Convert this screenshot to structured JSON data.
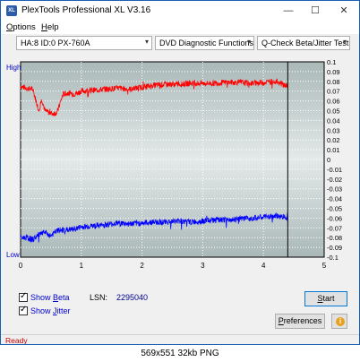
{
  "window": {
    "title": "PlexTools Professional XL V3.16",
    "icon": "XL",
    "controls": {
      "minimize": "—",
      "maximize": "☐",
      "close": "✕"
    }
  },
  "menu": {
    "options": {
      "mnemonic": "O",
      "rest": "ptions"
    },
    "help": {
      "mnemonic": "H",
      "rest": "elp"
    }
  },
  "toolbar": {
    "drive": "HA:8 ID:0  PX-760A",
    "function": "DVD Diagnostic Functions",
    "test": "Q-Check Beta/Jitter Test"
  },
  "chart_data": {
    "type": "line",
    "x_ticks": [
      "0",
      "1",
      "2",
      "3",
      "4",
      "5"
    ],
    "xlim": [
      0,
      5
    ],
    "left_labels": {
      "high": "High",
      "low": "Low"
    },
    "right_ticks": [
      "0.1",
      "0.09",
      "0.08",
      "0.07",
      "0.06",
      "0.05",
      "0.04",
      "0.03",
      "0.02",
      "0.01",
      "0",
      "-0.01",
      "-0.02",
      "-0.03",
      "-0.04",
      "-0.05",
      "-0.06",
      "-0.07",
      "-0.08",
      "-0.09",
      "-0.1"
    ],
    "ylim": [
      -0.1,
      0.1
    ],
    "end_marker_x": 4.4,
    "series": [
      {
        "name": "Beta",
        "color": "#ff0000",
        "x": [
          0,
          0.1,
          0.2,
          0.3,
          0.35,
          0.4,
          0.5,
          0.6,
          0.7,
          0.8,
          0.9,
          1.0,
          1.2,
          1.4,
          1.6,
          1.8,
          2.0,
          2.2,
          2.4,
          2.6,
          2.8,
          3.0,
          3.2,
          3.4,
          3.6,
          3.8,
          4.0,
          4.2,
          4.4
        ],
        "y": [
          0.075,
          0.073,
          0.072,
          0.05,
          0.062,
          0.05,
          0.047,
          0.048,
          0.067,
          0.068,
          0.067,
          0.07,
          0.071,
          0.072,
          0.073,
          0.072,
          0.074,
          0.076,
          0.077,
          0.077,
          0.078,
          0.078,
          0.078,
          0.079,
          0.079,
          0.078,
          0.079,
          0.08,
          0.075
        ]
      },
      {
        "name": "Jitter",
        "color": "#0000ff",
        "x": [
          0,
          0.1,
          0.2,
          0.3,
          0.4,
          0.5,
          0.6,
          0.7,
          0.8,
          0.9,
          1.0,
          1.2,
          1.4,
          1.6,
          1.8,
          2.0,
          2.2,
          2.4,
          2.6,
          2.8,
          3.0,
          3.2,
          3.4,
          3.6,
          3.8,
          4.0,
          4.2,
          4.4
        ],
        "y": [
          -0.08,
          -0.08,
          -0.082,
          -0.077,
          -0.075,
          -0.078,
          -0.073,
          -0.072,
          -0.072,
          -0.071,
          -0.069,
          -0.068,
          -0.067,
          -0.065,
          -0.066,
          -0.065,
          -0.064,
          -0.064,
          -0.063,
          -0.064,
          -0.063,
          -0.062,
          -0.062,
          -0.061,
          -0.06,
          -0.059,
          -0.058,
          -0.059
        ]
      }
    ]
  },
  "controls": {
    "show_beta": {
      "prefix": "Show ",
      "mnemonic": "B",
      "rest": "eta",
      "checked": true
    },
    "show_jitter": {
      "prefix": "Show ",
      "mnemonic": "J",
      "rest": "itter",
      "checked": true
    },
    "lsn_label": "LSN:",
    "lsn_value": "2295040",
    "start": {
      "mnemonic": "S",
      "rest": "tart"
    },
    "preferences": {
      "mnemonic": "P",
      "rest": "references"
    },
    "info_icon": "i"
  },
  "status": "Ready",
  "caption": "569x551  32kb  PNG"
}
